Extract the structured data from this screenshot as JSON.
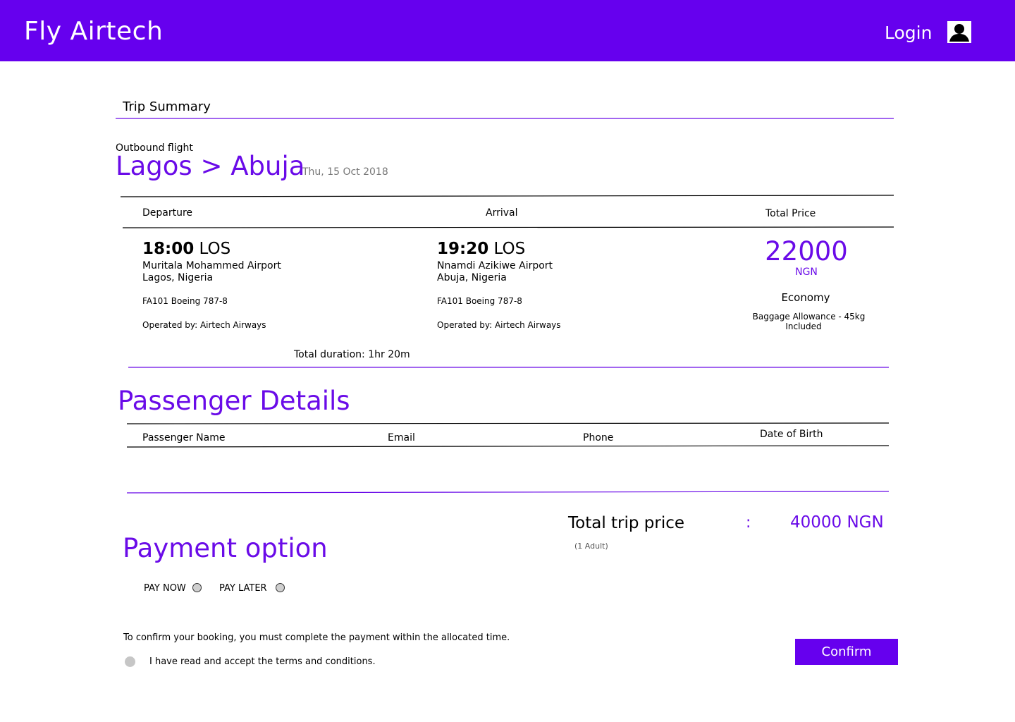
{
  "header": {
    "brand": "Fly Airtech",
    "login_label": "Login",
    "user_icon": "user-icon"
  },
  "summary": {
    "title": "Trip Summary",
    "flight_type": "Outbound flight",
    "route": "Lagos > Abuja",
    "date": "Thu, 15 Oct 2018"
  },
  "flight_table": {
    "headers": {
      "departure": "Departure",
      "arrival": "Arrival",
      "total_price": "Total Price"
    },
    "departure": {
      "time": "18:00",
      "code": "LOS",
      "airport": "Muritala Mohammed Airport",
      "city": "Lagos, Nigeria",
      "flight": "FA101 Boeing 787-8",
      "operator": "Operated by: Airtech Airways"
    },
    "arrival": {
      "time": "19:20",
      "code": "LOS",
      "airport": "Nnamdi Azikiwe Airport",
      "city": "Abuja, Nigeria",
      "flight": "FA101 Boeing 787-8",
      "operator": "Operated by: Airtech Airways"
    },
    "price": {
      "amount": "22000",
      "currency": "NGN",
      "cabin": "Economy",
      "baggage_line1": "Baggage Allowance - 45kg",
      "baggage_line2": "Included"
    },
    "duration": "Total duration: 1hr 20m"
  },
  "passenger": {
    "title": "Passenger Details",
    "columns": [
      "Passenger Name",
      "Email",
      "Phone",
      "Date of Birth"
    ]
  },
  "total": {
    "label": "Total trip price",
    "separator": ":",
    "amount": "40000 NGN",
    "note": "(1 Adult)"
  },
  "payment": {
    "title": "Payment option",
    "options": [
      "PAY NOW",
      "PAY LATER"
    ],
    "notice": "To confirm your booking, you must complete the payment within the allocated time.",
    "terms": "I have read and accept the terms and conditions.",
    "confirm_label": "Confirm"
  },
  "colors": {
    "brand": "#6600ee",
    "accent_text": "#6a0be8"
  }
}
